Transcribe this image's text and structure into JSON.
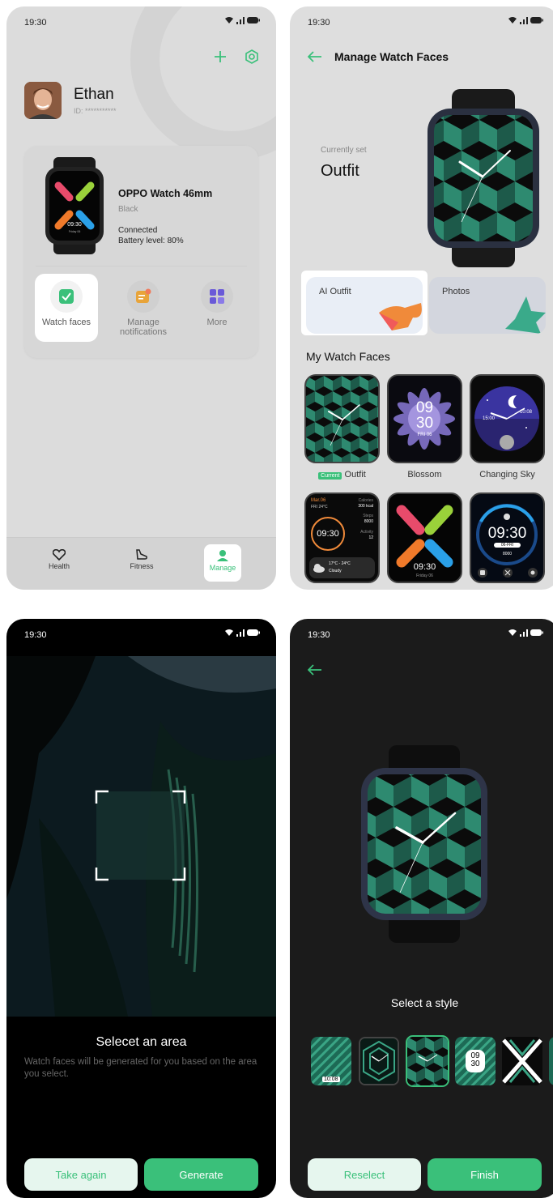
{
  "status": {
    "time": "19:30"
  },
  "screen1": {
    "user_name": "Ethan",
    "user_id": "ID: ***********",
    "device_name": "OPPO Watch 46mm",
    "device_color": "Black",
    "connection": "Connected",
    "battery": "Battery level: 80%",
    "watch_time": "09:30",
    "watch_date": "Friday 06",
    "actions": [
      {
        "label": "Watch faces"
      },
      {
        "label": "Manage notifications"
      },
      {
        "label": "More"
      }
    ],
    "tabs": [
      {
        "label": "Health"
      },
      {
        "label": "Fitness"
      },
      {
        "label": "Manage"
      }
    ]
  },
  "screen2": {
    "title": "Manage Watch Faces",
    "currently_set_label": "Currently set",
    "current_face": "Outfit",
    "options": [
      {
        "label": "AI Outfit"
      },
      {
        "label": "Photos"
      }
    ],
    "section_title": "My Watch Faces",
    "current_badge": "Current",
    "faces": [
      {
        "label": "Outfit"
      },
      {
        "label": "Blossom"
      },
      {
        "label": "Changing Sky"
      }
    ],
    "blossom_hour": "09",
    "blossom_min": "30",
    "blossom_date": "FRI 06",
    "sky_left": "15:00",
    "sky_right": "10:08",
    "info_face": {
      "date": "Mar.06",
      "weather": "FRI 24°C",
      "calories_label": "Calories",
      "calories_value": "300 kcal",
      "steps_label": "Steps",
      "steps_value": "8000",
      "activity_label": "Activity",
      "activity_value": "12",
      "time": "09:30",
      "temp": "17°C - 24°C",
      "condition": "Cloudy"
    },
    "x_face": {
      "time": "09:30",
      "date": "Friday 06"
    },
    "digital_face": {
      "time": "09:30",
      "date": "06-FRI",
      "steps": "8000"
    }
  },
  "screen3": {
    "title": "Selecet an area",
    "description": "Watch faces will be generated for you based on the area you select.",
    "take_again": "Take again",
    "generate": "Generate"
  },
  "screen4": {
    "title": "Select a style",
    "style_time": "10:08",
    "style_hour": "09",
    "style_min": "30",
    "reselect": "Reselect",
    "finish": "Finish"
  },
  "colors": {
    "accent": "#3ac07a",
    "accent_light": "#e6f6ee",
    "teal": "#2e8a70",
    "dark_teal": "#1d5a4a"
  }
}
